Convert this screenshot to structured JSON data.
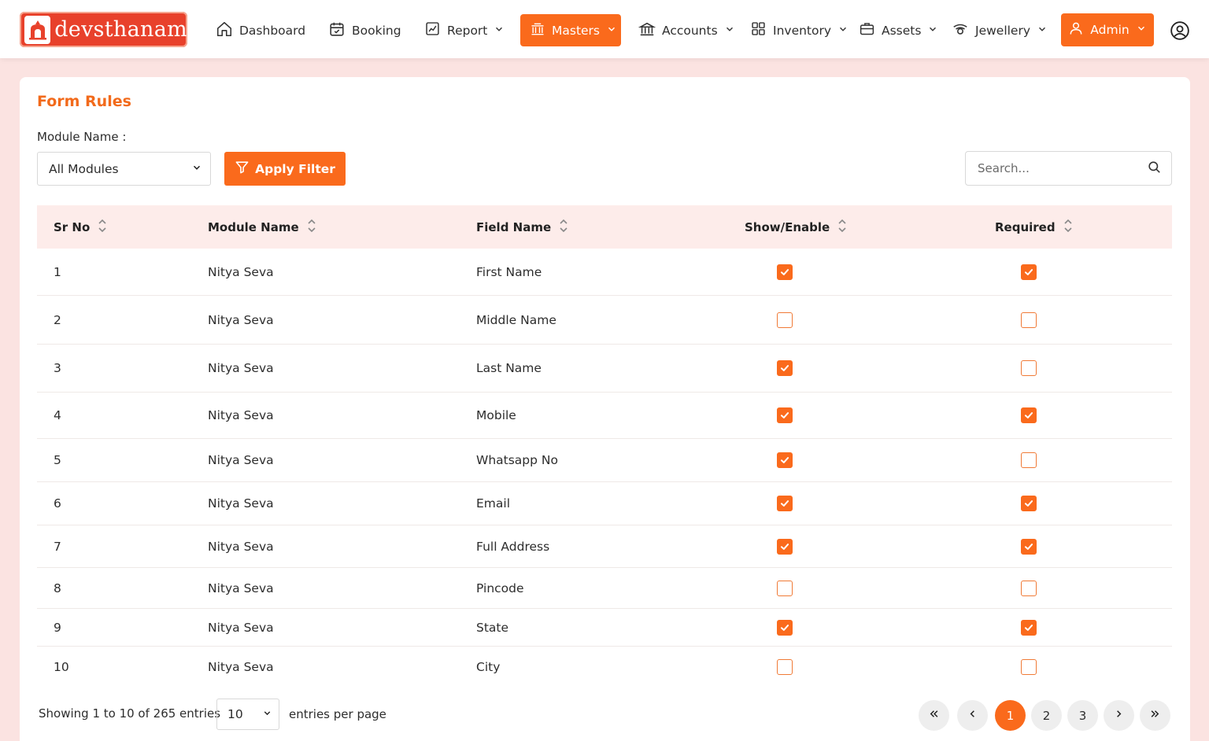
{
  "brand": {
    "name": "devsthanam"
  },
  "nav": {
    "items": [
      {
        "label": "Dashboard",
        "icon": "home-icon"
      },
      {
        "label": "Booking",
        "icon": "calendar-check-icon"
      },
      {
        "label": "Report",
        "icon": "report-icon"
      },
      {
        "label": "Masters",
        "icon": "masters-icon"
      },
      {
        "label": "Accounts",
        "icon": "bank-icon"
      },
      {
        "label": "Inventory",
        "icon": "grid-icon"
      },
      {
        "label": "Assets",
        "icon": "briefcase-icon"
      },
      {
        "label": "Jewellery",
        "icon": "jewel-icon"
      }
    ],
    "active": "Masters",
    "admin_label": "Admin"
  },
  "page": {
    "title": "Form Rules",
    "filter_label": "Module Name :",
    "module_select_value": "All Modules",
    "apply_filter_label": "Apply Filter",
    "search_placeholder": "Search..."
  },
  "table": {
    "columns": [
      "Sr No",
      "Module Name",
      "Field Name",
      "Show/Enable",
      "Required"
    ],
    "rows": [
      {
        "sr": "1",
        "module": "Nitya Seva",
        "field": "First Name",
        "show": true,
        "required": true
      },
      {
        "sr": "2",
        "module": "Nitya Seva",
        "field": "Middle Name",
        "show": false,
        "required": false
      },
      {
        "sr": "3",
        "module": "Nitya Seva",
        "field": "Last Name",
        "show": true,
        "required": false
      },
      {
        "sr": "4",
        "module": "Nitya Seva",
        "field": "Mobile",
        "show": true,
        "required": true
      },
      {
        "sr": "5",
        "module": "Nitya Seva",
        "field": "Whatsapp No",
        "show": true,
        "required": false
      },
      {
        "sr": "6",
        "module": "Nitya Seva",
        "field": "Email",
        "show": true,
        "required": true
      },
      {
        "sr": "7",
        "module": "Nitya Seva",
        "field": "Full Address",
        "show": true,
        "required": true
      },
      {
        "sr": "8",
        "module": "Nitya Seva",
        "field": "Pincode",
        "show": false,
        "required": false
      },
      {
        "sr": "9",
        "module": "Nitya Seva",
        "field": "State",
        "show": true,
        "required": true
      },
      {
        "sr": "10",
        "module": "Nitya Seva",
        "field": "City",
        "show": false,
        "required": false
      }
    ]
  },
  "footer": {
    "showing_text": "Showing 1 to 10 of 265 entries",
    "per_page_value": "10",
    "per_page_label": "entries per page",
    "pages": [
      "1",
      "2",
      "3"
    ],
    "current_page": "1"
  },
  "colors": {
    "accent": "#fa6a1c",
    "title": "#f26a1b",
    "header_bg": "#fdecea",
    "page_bg": "#fbe3e1"
  }
}
